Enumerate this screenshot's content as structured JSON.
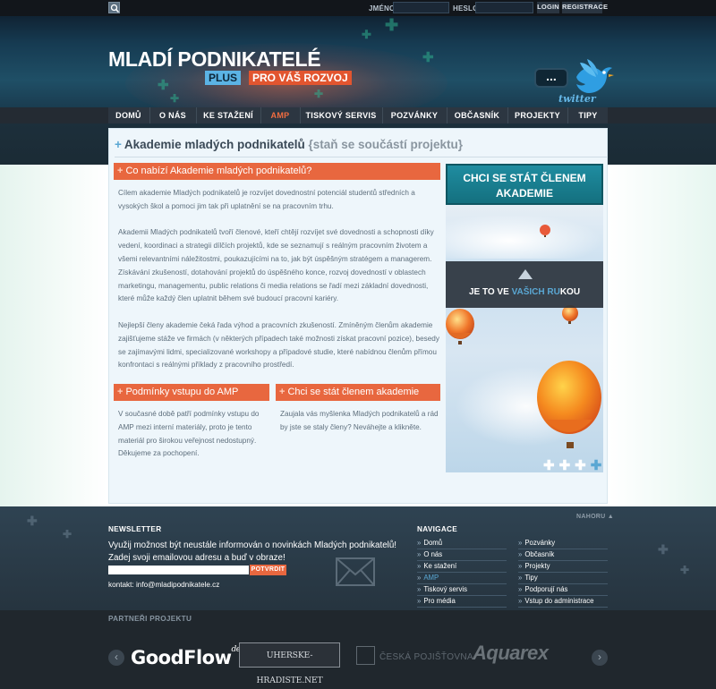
{
  "topbar": {
    "name_label": "JMÉNO",
    "password_label": "HESLO",
    "login_label": "LOGIN",
    "register_label": "REGISTRACE"
  },
  "header": {
    "brand": "MLADÍ PODNIKATELÉ",
    "plus": "PLUS",
    "slogan": "PRO VÁŠ ROZVOJ",
    "bubble": "...",
    "twitter": "twitter"
  },
  "nav": {
    "items": [
      {
        "label": "DOMŮ"
      },
      {
        "label": "O NÁS"
      },
      {
        "label": "KE STAŽENÍ"
      },
      {
        "label": "AMP"
      },
      {
        "label": "TISKOVÝ SERVIS"
      },
      {
        "label": "POZVÁNKY"
      },
      {
        "label": "OBČASNÍK"
      },
      {
        "label": "PROJEKTY"
      },
      {
        "label": "TIPY"
      }
    ],
    "active": "AMP"
  },
  "page": {
    "title": "Akademie mladých podnikatelů",
    "subtitle": "{staň se součástí projektu}"
  },
  "section1": {
    "heading": "Co nabízí Akademie mladých podnikatelů?",
    "p1": [
      "Cílem akademie Mladých podnikatelů je rozvíjet dovednostní potenciál studentů středních a",
      "vysokých škol a pomoci jim tak při uplatnění se na pracovním trhu."
    ],
    "p2": [
      "Akademii Mladých podnikatelů tvoří členové, kteří chtějí rozvíjet své dovednosti a schopnosti díky",
      "vedení, koordinaci a strategii dílčích projektů, kde se seznamují s reálným pracovním životem a",
      "všemi relevantními náležitostmi, poukazujícími na to, jak být úspěšným stratégem a managerem.",
      "Získávání zkušeností, dotahování projektů do úspěšného konce, rozvoj dovedností v oblastech",
      "marketingu, managementu, public relations či media relations se řadí mezi základní dovednosti,",
      "které může každý člen uplatnit během své budoucí pracovní kariéry."
    ],
    "p3": [
      "Nejlepší členy akademie čeká řada výhod a pracovních zkušeností. Zmíněným členům akademie",
      "zajišťujeme stáže ve firmách (v některých případech také možnosti získat pracovní pozice), besedy",
      "se zajímavými lidmi, specializované workshopy a případové studie, které nabídnou členům přímou",
      "konfrontaci s reálnými příklady z pracovního prostředí."
    ]
  },
  "section2": {
    "heading": "Podmínky vstupu do AMP",
    "lines": [
      "V současné době patří podmínky vstupu do",
      "AMP mezi interní materiály, proto je tento",
      "materiál pro širokou veřejnost nedostupný.",
      "Děkujeme za pochopení."
    ]
  },
  "section3": {
    "heading": "Chci se stát členem akademie",
    "lines": [
      "Zaujala vás myšlenka Mladých podnikatelů a rád",
      "by jste se staly členy? Neváhejte a klikněte."
    ]
  },
  "sidebar": {
    "cta": [
      "CHCI SE STÁT ČLENEM",
      "AKADEMIE"
    ],
    "band_text_1": "JE TO VE ",
    "band_text_hl": "VAŠICH RU",
    "band_text_2": "KOU",
    "slider_dots": "+ + + +"
  },
  "footer": {
    "top_link": "NAHORU ▲",
    "newsletter_title": "NEWSLETTER",
    "newsletter_text": [
      "Využij možnost být neustále informován o novinkách Mladých podnikatelů!",
      "Zadej svoji emailovou adresu a buď v obraze!"
    ],
    "newsletter_button": "POTVRDIT",
    "contact": "kontakt: info@mladipodnikatele.cz",
    "nav_title": "NAVIGACE",
    "nav_col1": [
      "Domů",
      "O nás",
      "Ke stažení",
      "AMP",
      "Tiskový servis",
      "Pro média"
    ],
    "nav_col2": [
      "Pozvánky",
      "Občasník",
      "Projekty",
      "Tipy",
      "Podporují nás",
      "Vstup do administrace"
    ],
    "nav_active": "AMP"
  },
  "partners": {
    "label": "PARTNEŘI PROJEKTU",
    "prev": "‹",
    "next": "›",
    "goodflow": "GoodFlow",
    "goodflow_sup": "design",
    "uh": "UHERSKE-HRADISTE.NET",
    "cp": "ČESKÁ POJIŠŤOVNA",
    "aquarex": "Aquarex"
  },
  "colors": {
    "accent_orange": "#e8673f",
    "accent_blue": "#5aa7d3",
    "cta_teal": "#1f8ca0"
  }
}
